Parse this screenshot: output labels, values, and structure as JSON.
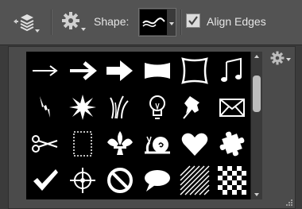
{
  "options_bar": {
    "tool_preset_icon": "stack-layers-icon",
    "settings_icon": "gear-icon",
    "shape_label": "Shape:",
    "shape_selected_icon": "wave-shape-icon",
    "align_edges_checked": true,
    "align_edges_label": "Align Edges"
  },
  "shape_panel": {
    "menu_icon": "gear-icon",
    "shapes": [
      "thin-arrow-icon",
      "bold-arrow-icon",
      "heavy-arrow-icon",
      "banner-icon",
      "frame-icon",
      "music-notes-icon",
      "lightning-icon",
      "starburst-icon",
      "grass-icon",
      "lightbulb-icon",
      "pushpin-icon",
      "envelope-icon",
      "scissors-icon",
      "stamp-frame-icon",
      "fleur-de-lis-icon",
      "snail-icon",
      "heart-icon",
      "puzzle-piece-icon",
      "checkmark-icon",
      "crosshair-icon",
      "no-sign-icon",
      "speech-bubble-icon",
      "diagonal-lines-icon",
      "checkerboard-icon"
    ]
  }
}
